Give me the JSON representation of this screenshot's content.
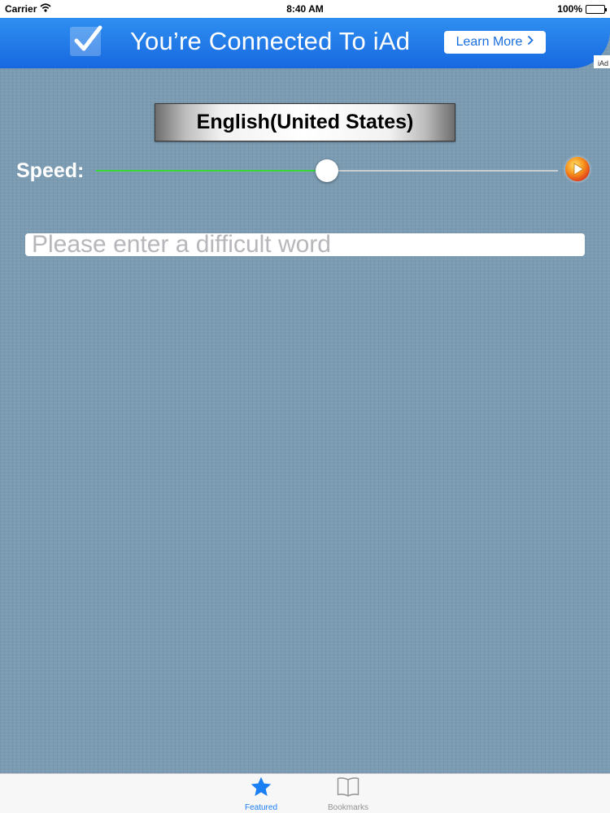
{
  "status_bar": {
    "carrier": "Carrier",
    "time": "8:40 AM",
    "battery": "100%"
  },
  "ad_banner": {
    "headline": "You’re Connected To iAd",
    "button_label": "Learn More",
    "tag": "iAd",
    "color": "#1d6fe8"
  },
  "language": {
    "selected": "English(United States)"
  },
  "speed": {
    "label": "Speed:",
    "value": 0.5,
    "track_fill_color": "#39d83a"
  },
  "word_input": {
    "value": "",
    "placeholder": "Please enter a difficult word"
  },
  "tab_bar": {
    "active_color": "#1a7ef5",
    "tabs": [
      {
        "label": "Featured",
        "icon": "star-icon",
        "active": true
      },
      {
        "label": "Bookmarks",
        "icon": "book-icon",
        "active": false
      }
    ]
  }
}
